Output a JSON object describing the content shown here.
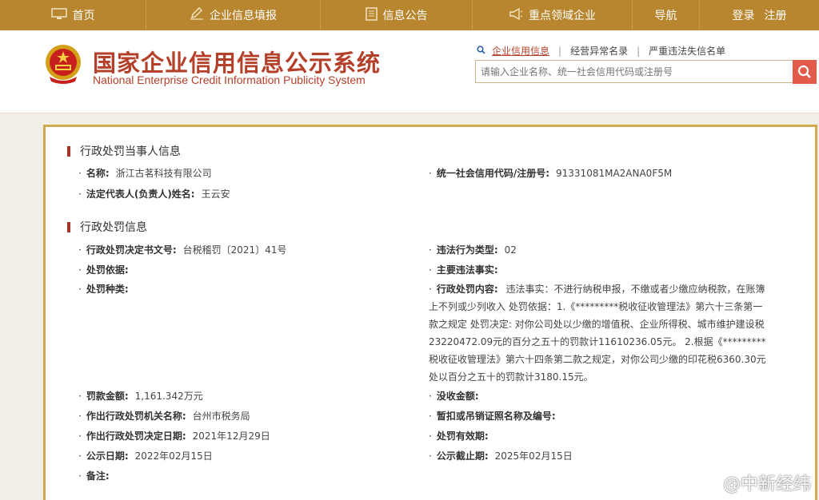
{
  "nav": {
    "items": [
      {
        "label": "首页",
        "icon": "monitor-icon"
      },
      {
        "label": "企业信息填报",
        "icon": "edit-icon"
      },
      {
        "label": "信息公告",
        "icon": "document-icon"
      },
      {
        "label": "重点领域企业",
        "icon": "megaphone-icon"
      },
      {
        "label": "导航",
        "icon": ""
      }
    ],
    "login": "登录",
    "register": "注册"
  },
  "header": {
    "title_cn": "国家企业信用信息公示系统",
    "title_en": "National Enterprise Credit Information Publicity System",
    "links": [
      "企业信用信息",
      "经营异常名录",
      "严重违法失信名单"
    ],
    "search_placeholder": "请输入企业名称、统一社会信用代码或注册号"
  },
  "party": {
    "section_title": "行政处罚当事人信息",
    "name_label": "名称:",
    "name_value": "浙江古茗科技有限公司",
    "credit_code_label": "统一社会信用代码/注册号:",
    "credit_code_value": "91331081MA2ANA0F5M",
    "legal_rep_label": "法定代表人(负责人)姓名:",
    "legal_rep_value": "王云安"
  },
  "penalty": {
    "section_title": "行政处罚信息",
    "doc_no_label": "行政处罚决定书文号:",
    "doc_no_value": "台税稽罚〔2021〕41号",
    "violation_type_label": "违法行为类型:",
    "violation_type_value": "02",
    "basis_label": "处罚依据:",
    "facts_label": "主要违法事实:",
    "kind_label": "处罚种类:",
    "content_label": "行政处罚内容:",
    "content_value": "违法事实：不进行纳税申报，不缴或者少缴应纳税款，在账簿上不列或少列收入 处罚依据：1.《*********税收征收管理法》第六十三条第一款之规定 处罚决定: 对你公司处以少缴的增值税、企业所得税、城市维护建设税23220472.09元的百分之五十的罚款计11610236.05元。 2.根据《*********税收征收管理法》第六十四条第二款之规定，对你公司少缴的印花税6360.30元处以百分之五十的罚款计3180.15元。",
    "fine_label": "罚款金额:",
    "fine_value": "1,161.342万元",
    "confiscation_label": "没收金额:",
    "authority_label": "作出行政处罚机关名称:",
    "authority_value": "台州市税务局",
    "license_label": "暂扣或吊销证照名称及编号:",
    "decision_date_label": "作出行政处罚决定日期:",
    "decision_date_value": "2021年12月29日",
    "validity_label": "处罚有效期:",
    "publish_date_label": "公示日期:",
    "publish_date_value": "2022年02月15日",
    "publish_end_label": "公示截止期:",
    "publish_end_value": "2025年02月15日",
    "remarks_label": "备注:"
  },
  "watermark": "@中新经纬",
  "colors": {
    "nav_bg": "#b8862e",
    "title": "#b5402a",
    "panel_border": "#d3a94d",
    "search_btn": "#e25a4a"
  }
}
